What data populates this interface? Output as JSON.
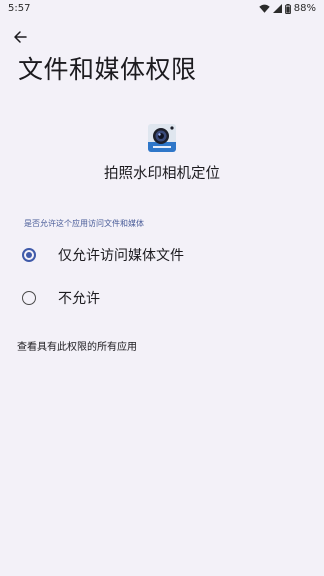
{
  "status_bar": {
    "time": "5:57",
    "battery": "88%"
  },
  "page": {
    "title": "文件和媒体权限"
  },
  "app": {
    "name": "拍照水印相机定位"
  },
  "permission": {
    "section_header": "是否允许这个应用访问文件和媒体",
    "options": [
      {
        "label": "仅允许访问媒体文件",
        "selected": true
      },
      {
        "label": "不允许",
        "selected": false
      }
    ]
  },
  "footer": {
    "view_all_link": "查看具有此权限的所有应用"
  },
  "colors": {
    "background": "#F3F1F8",
    "accent": "#3F5AA9",
    "text": "#1C1B1F"
  },
  "icons": {
    "back": "arrow-left-icon",
    "wifi": "wifi-icon",
    "signal": "signal-icon",
    "battery": "battery-icon",
    "app": "camera-app-icon"
  }
}
